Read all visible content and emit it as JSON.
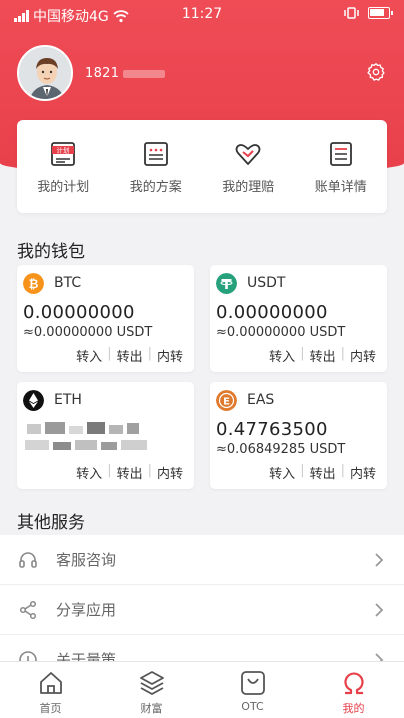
{
  "status_bar": {
    "carrier": "中国移动4G",
    "time": "11:27"
  },
  "profile": {
    "username": "1821"
  },
  "quick_actions": [
    {
      "label": "我的计划",
      "icon": "plan-icon",
      "icon_text": "计划"
    },
    {
      "label": "我的方案",
      "icon": "scheme-icon"
    },
    {
      "label": "我的理赔",
      "icon": "claim-icon"
    },
    {
      "label": "账单详情",
      "icon": "bill-icon"
    }
  ],
  "wallet": {
    "title": "我的钱包",
    "actions": {
      "transfer_in": "转入",
      "transfer_out": "转出",
      "internal": "内转"
    },
    "coins": [
      {
        "symbol": "BTC",
        "amount": "0.00000000",
        "usdt": "≈0.00000000 USDT",
        "icon": "btc-icon",
        "color": "#f7931a",
        "glyph": "₿"
      },
      {
        "symbol": "USDT",
        "amount": "0.00000000",
        "usdt": "≈0.00000000 USDT",
        "icon": "usdt-icon",
        "color": "#26a17b",
        "glyph": "T"
      },
      {
        "symbol": "ETH",
        "amount": "",
        "usdt": "",
        "icon": "eth-icon",
        "color": "#111111",
        "glyph": "◆"
      },
      {
        "symbol": "EAS",
        "amount": "0.47763500",
        "usdt": "≈0.06849285 USDT",
        "icon": "eas-icon",
        "color": "#e07a2d",
        "glyph": "E"
      }
    ]
  },
  "services": {
    "title": "其他服务",
    "items": [
      {
        "label": "客服咨询",
        "icon": "headset-icon"
      },
      {
        "label": "分享应用",
        "icon": "share-icon"
      },
      {
        "label": "关于量策",
        "icon": "info-icon"
      }
    ]
  },
  "tabbar": [
    {
      "label": "首页",
      "icon": "home-icon"
    },
    {
      "label": "财富",
      "icon": "layers-icon"
    },
    {
      "label": "OTC",
      "icon": "otc-icon"
    },
    {
      "label": "我的",
      "icon": "omega-icon",
      "active": true
    }
  ],
  "colors": {
    "accent": "#e8404b",
    "background": "#f2f2f4"
  }
}
